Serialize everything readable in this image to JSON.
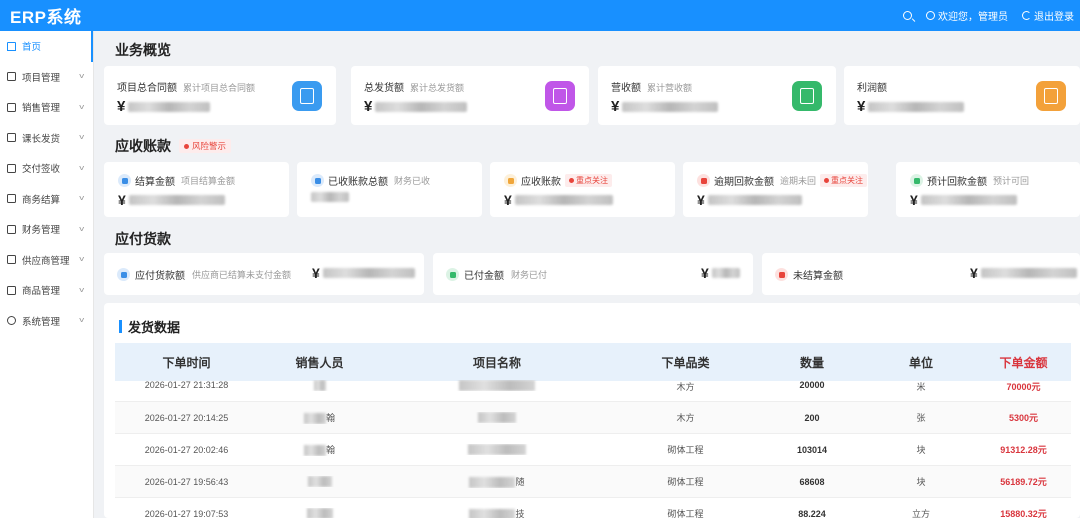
{
  "header": {
    "brand": "ERP系统",
    "welcome": "欢迎您，管理员",
    "logout": "退出登录"
  },
  "sidebar": {
    "items": [
      {
        "label": "首页",
        "icon": "home-icon",
        "active": true
      },
      {
        "label": "项目管理",
        "icon": "folder-icon"
      },
      {
        "label": "销售管理",
        "icon": "cart-icon"
      },
      {
        "label": "课长发货",
        "icon": "doc-icon"
      },
      {
        "label": "交付签收",
        "icon": "check-icon"
      },
      {
        "label": "商务结算",
        "icon": "calc-icon"
      },
      {
        "label": "财务管理",
        "icon": "wallet-icon"
      },
      {
        "label": "供应商管理",
        "icon": "supplier-icon"
      },
      {
        "label": "商品管理",
        "icon": "box-icon"
      },
      {
        "label": "系统管理",
        "icon": "gear-icon"
      }
    ]
  },
  "overview": {
    "title": "业务概览",
    "cards": [
      {
        "label": "项目总合同额",
        "sub": "累计项目总合同额",
        "value_prefix": "¥",
        "color": "#3a9bf0"
      },
      {
        "label": "总发货额",
        "sub": "累计总发货额",
        "value_prefix": "¥",
        "color": "#c056e8"
      },
      {
        "label": "营收额",
        "sub": "累计营收额",
        "value_prefix": "¥",
        "color": "#35b96b"
      },
      {
        "label": "利润额",
        "sub": "",
        "value_prefix": "¥",
        "color": "#f3a13a"
      }
    ]
  },
  "receivable": {
    "title": "应收账款",
    "badge": "风险警示",
    "cards": [
      {
        "label": "结算金额",
        "sub": "项目结算金额",
        "tag": "",
        "value_prefix": "¥",
        "color": "#3a8ee6"
      },
      {
        "label": "已收账款总额",
        "sub": "财务已收",
        "tag": "",
        "value_prefix": "",
        "color": "#3a8ee6"
      },
      {
        "label": "应收账款",
        "sub": "",
        "tag": "重点关注",
        "value_prefix": "¥",
        "color": "#f0a63a"
      },
      {
        "label": "逾期回款金额",
        "sub": "逾期未回",
        "tag": "重点关注",
        "value_prefix": "¥",
        "color": "#e8453c"
      },
      {
        "label": "预计回款金额",
        "sub": "预计可回",
        "tag": "",
        "value_prefix": "¥",
        "color": "#35b96b"
      }
    ]
  },
  "payable": {
    "title": "应付货款",
    "cards": [
      {
        "label": "应付货款额",
        "sub": "供应商已结算未支付金额",
        "value_prefix": "¥",
        "color": "#3a8ee6"
      },
      {
        "label": "已付金额",
        "sub": "财务已付",
        "value_prefix": "¥",
        "color": "#35b96b"
      },
      {
        "label": "未结算金额",
        "sub": "",
        "value_prefix": "¥",
        "color": "#e8453c"
      }
    ]
  },
  "shipping": {
    "title": "发货数据",
    "columns": [
      "下单时间",
      "销售人员",
      "项目名称",
      "下单品类",
      "数量",
      "单位",
      "下单金额"
    ],
    "rows": [
      {
        "time": "2026-01-27 21:31:28",
        "seller_suffix": "",
        "project_suffix": "",
        "category": "木方",
        "qty": "20000",
        "unit": "米",
        "amount": "70000元"
      },
      {
        "time": "2026-01-27 20:14:25",
        "seller_suffix": "翰",
        "project_suffix": "",
        "category": "木方",
        "qty": "200",
        "unit": "张",
        "amount": "5300元"
      },
      {
        "time": "2026-01-27 20:02:46",
        "seller_suffix": "翰",
        "project_suffix": "",
        "category": "砌体工程",
        "qty": "103014",
        "unit": "块",
        "amount": "91312.28元"
      },
      {
        "time": "2026-01-27 19:56:43",
        "seller_suffix": "",
        "project_suffix": "随",
        "category": "砌体工程",
        "qty": "68608",
        "unit": "块",
        "amount": "56189.72元"
      },
      {
        "time": "2026-01-27 19:07:53",
        "seller_suffix": "",
        "project_suffix": "技",
        "category": "砌体工程",
        "qty": "88.224",
        "unit": "立方",
        "amount": "15880.32元"
      }
    ]
  }
}
